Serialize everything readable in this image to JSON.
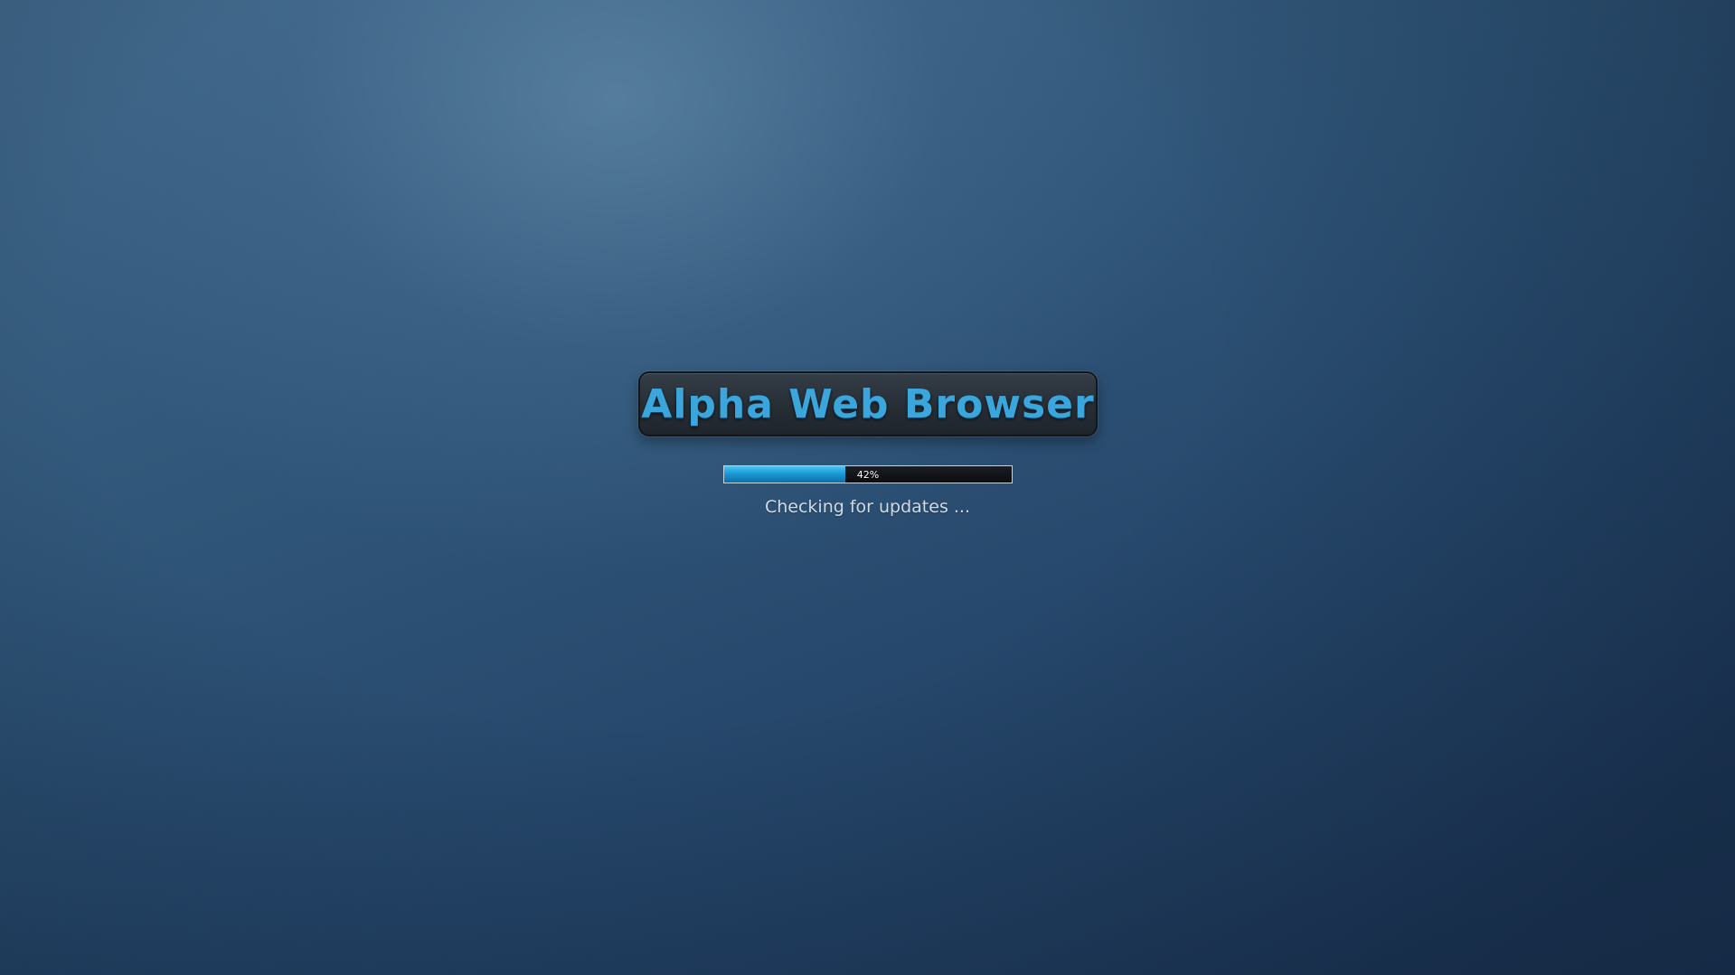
{
  "splash": {
    "title": "Alpha Web Browser",
    "status": "Checking for updates ...",
    "progress": {
      "value": 42,
      "label": "42%"
    }
  },
  "colors": {
    "accent": "#3aa6db",
    "progress_fill": "#1a9ad6",
    "background": "#2f5578"
  }
}
